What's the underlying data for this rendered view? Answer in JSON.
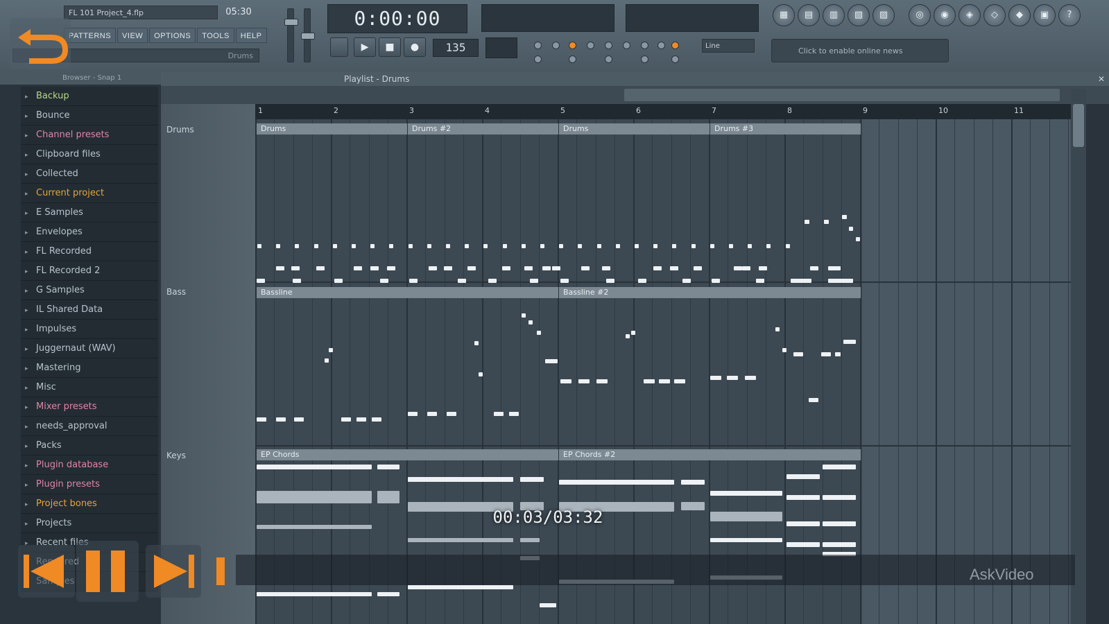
{
  "app": {
    "project_file": "FL 101 Project_4.flp",
    "title_time": "05:30",
    "hint_text": "Drums",
    "menu": [
      "PATTERNS",
      "VIEW",
      "OPTIONS",
      "TOOLS",
      "HELP"
    ],
    "song_time": "0:00:00",
    "tempo": "135",
    "snap": "Line",
    "online_hint": "Click to enable online news"
  },
  "browser": {
    "header": "Browser - Snap 1",
    "folders": [
      {
        "label": "Backup",
        "style": "green"
      },
      {
        "label": "Bounce",
        "style": ""
      },
      {
        "label": "Channel presets",
        "style": "pink"
      },
      {
        "label": "Clipboard files",
        "style": ""
      },
      {
        "label": "Collected",
        "style": ""
      },
      {
        "label": "Current project",
        "style": "highlight"
      },
      {
        "label": "E Samples",
        "style": ""
      },
      {
        "label": "Envelopes",
        "style": ""
      },
      {
        "label": "FL Recorded",
        "style": ""
      },
      {
        "label": "FL Recorded 2",
        "style": ""
      },
      {
        "label": "G Samples",
        "style": ""
      },
      {
        "label": "IL Shared Data",
        "style": ""
      },
      {
        "label": "Impulses",
        "style": ""
      },
      {
        "label": "Juggernaut (WAV)",
        "style": ""
      },
      {
        "label": "Mastering",
        "style": ""
      },
      {
        "label": "Misc",
        "style": ""
      },
      {
        "label": "Mixer presets",
        "style": "pink"
      },
      {
        "label": "needs_approval",
        "style": ""
      },
      {
        "label": "Packs",
        "style": ""
      },
      {
        "label": "Plugin database",
        "style": "pink"
      },
      {
        "label": "Plugin presets",
        "style": "pink"
      },
      {
        "label": "Project bones",
        "style": "highlight"
      },
      {
        "label": "Projects",
        "style": ""
      },
      {
        "label": "Recent files",
        "style": ""
      },
      {
        "label": "Rendered",
        "style": ""
      },
      {
        "label": "Samples",
        "style": ""
      }
    ]
  },
  "playlist": {
    "title": "Playlist - Drums",
    "ruler": [
      "1",
      "2",
      "3",
      "4",
      "5",
      "6",
      "7",
      "8",
      "9",
      "10",
      "11"
    ],
    "tracks": [
      "Drums",
      "Bass",
      "Keys"
    ],
    "clips": {
      "drums": [
        "Drums",
        "Drums #2",
        "Drums",
        "Drums #3"
      ],
      "bass": [
        "Bassline",
        "Bassline #2"
      ],
      "keys": [
        "EP Chords",
        "EP Chords #2"
      ]
    }
  },
  "video": {
    "time": "00:03/03:32",
    "watermark": "AskVideo"
  }
}
